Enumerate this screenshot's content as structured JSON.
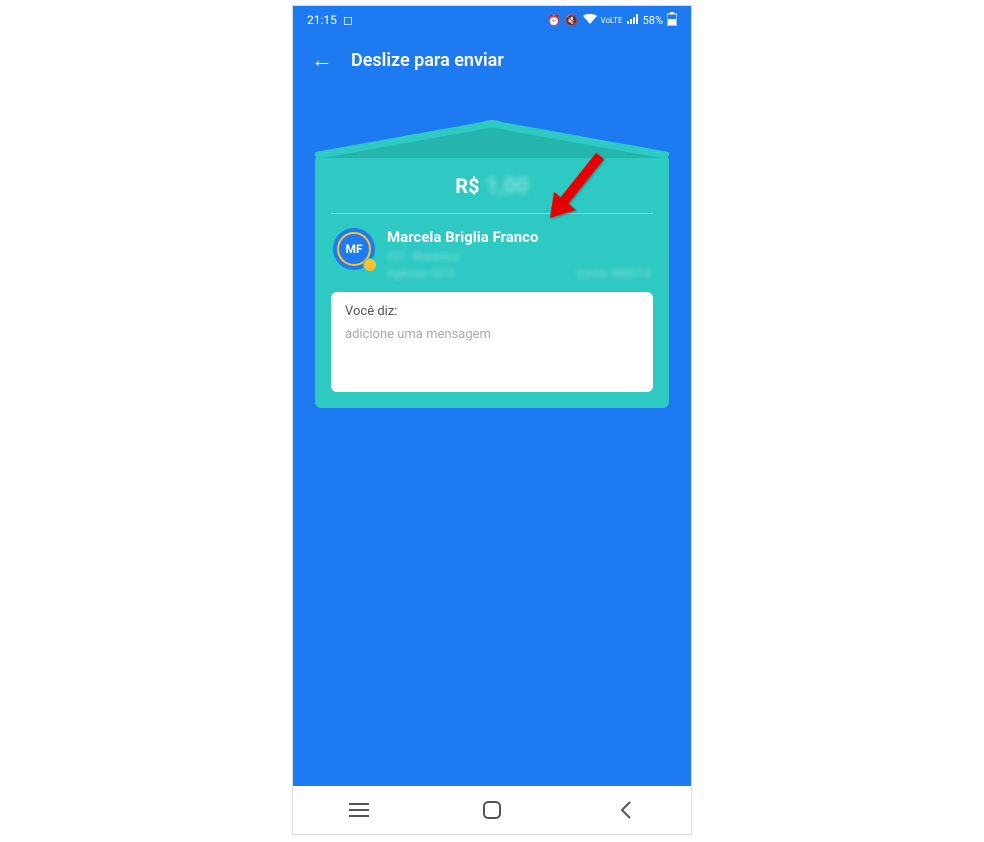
{
  "status_bar": {
    "time": "21:15",
    "battery": "58%",
    "lte_label": "VoLTE"
  },
  "header": {
    "title": "Deslize para enviar"
  },
  "card": {
    "currency_label": "R$",
    "amount_value": "1,00",
    "recipient": {
      "initials": "MF",
      "name": "Marcela Briglia Franco",
      "bank_line": "237 · Bradesco",
      "agency_label": "Agência 1073",
      "account_label": "Conta: 00037-3"
    },
    "message": {
      "label": "Você diz:",
      "placeholder": "adicione uma mensagem"
    }
  }
}
